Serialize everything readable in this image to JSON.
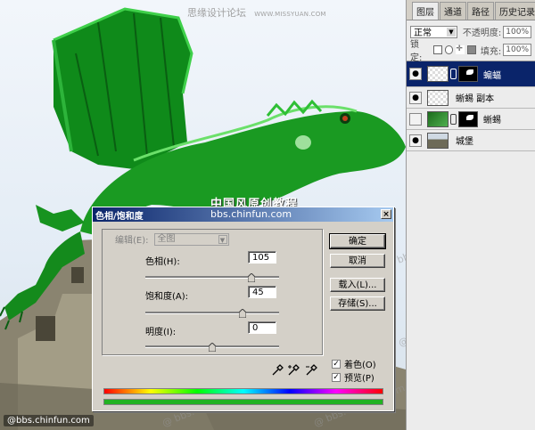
{
  "site": {
    "forum_name": "思缘设计论坛",
    "url": "WWW.MISSYUAN.COM"
  },
  "canvas": {
    "banner_text": "中国风原创教程",
    "banner_url": "bbs.chinfun.com",
    "watermark": "@ bbs.ChinFun.com",
    "bottom_url": "@bbs.chinfun.com"
  },
  "layers_panel": {
    "tabs": [
      "图层",
      "通道",
      "路径",
      "历史记录"
    ],
    "active_tab": 0,
    "blend_mode": "正常",
    "opacity_label": "不透明度:",
    "opacity_value": "100%",
    "lock_label": "锁定:",
    "fill_label": "填充:",
    "fill_value": "100%",
    "layers": [
      {
        "name": "蝙蝠",
        "visible": true,
        "selected": true,
        "thumb": "checker",
        "mask": true
      },
      {
        "name": "蜥蜴 副本",
        "visible": true,
        "selected": false,
        "thumb": "checker",
        "mask": false
      },
      {
        "name": "蜥蜴",
        "visible": false,
        "selected": false,
        "thumb": "green",
        "mask": true
      },
      {
        "name": "城堡",
        "visible": true,
        "selected": false,
        "thumb": "castle",
        "mask": false
      }
    ]
  },
  "dialog": {
    "title": "色相/饱和度",
    "close": "×",
    "edit_label": "编辑(E):",
    "edit_value": "全图",
    "hue_label": "色相(H):",
    "hue_value": "105",
    "hue_range": [
      -180,
      180
    ],
    "saturation_label": "饱和度(A):",
    "saturation_value": "45",
    "saturation_range": [
      -100,
      100
    ],
    "lightness_label": "明度(I):",
    "lightness_value": "0",
    "lightness_range": [
      -100,
      100
    ],
    "buttons": {
      "ok": "确定",
      "cancel": "取消",
      "load": "载入(L)...",
      "save": "存储(S)..."
    },
    "colorize_label": "着色(O)",
    "colorize_checked": true,
    "preview_label": "预览(P)",
    "preview_checked": true
  },
  "colors": {
    "selected_layer": "#0a246a",
    "dialog_bg": "#d4d0c8",
    "colorize_bar": "#22b222"
  }
}
